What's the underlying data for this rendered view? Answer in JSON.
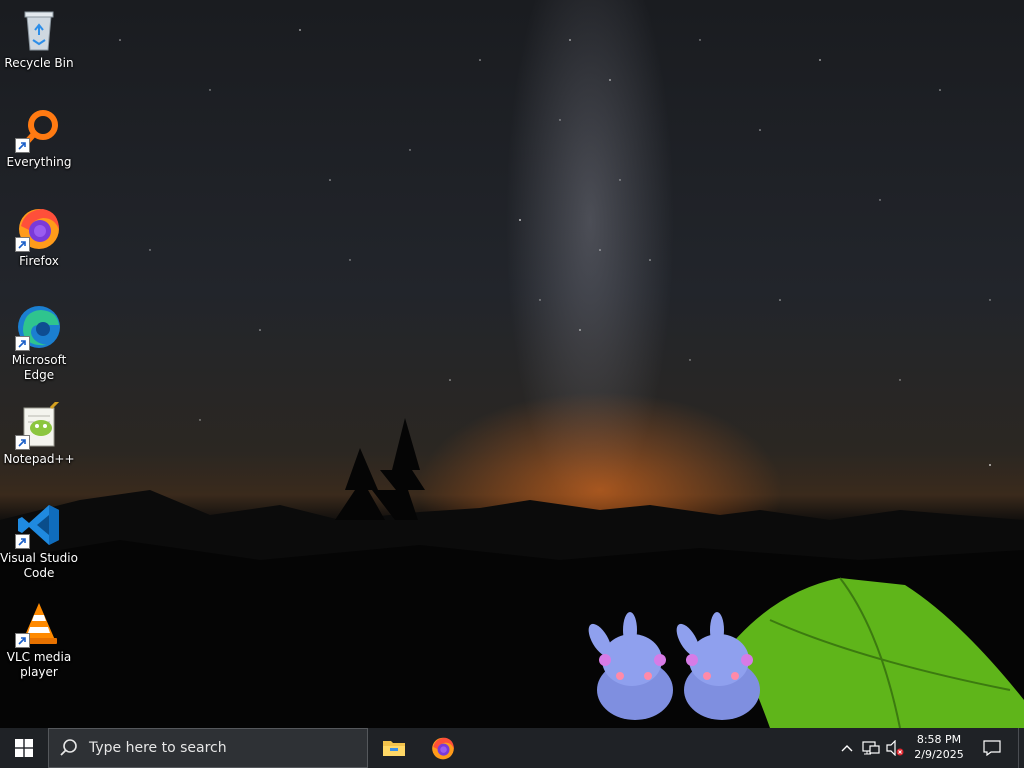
{
  "desktop": {
    "icons": [
      {
        "label": "Recycle Bin",
        "icon": "recycle-bin-icon",
        "shortcut": false
      },
      {
        "label": "Everything",
        "icon": "everything-search-icon",
        "shortcut": true
      },
      {
        "label": "Firefox",
        "icon": "firefox-icon",
        "shortcut": true
      },
      {
        "label": "Microsoft Edge",
        "icon": "edge-icon",
        "shortcut": true
      },
      {
        "label": "Notepad++",
        "icon": "notepad-plus-plus-icon",
        "shortcut": true
      },
      {
        "label": "Visual Studio Code",
        "icon": "vscode-icon",
        "shortcut": true
      },
      {
        "label": "VLC media player",
        "icon": "vlc-icon",
        "shortcut": true
      }
    ],
    "wallpaper": "night-sky-milky-way-tent-wallpaper"
  },
  "taskbar": {
    "start_icon": "windows-logo-icon",
    "search": {
      "placeholder": "Type here to search",
      "icon": "search-icon"
    },
    "pinned": [
      {
        "name": "File Explorer",
        "icon": "file-explorer-icon"
      },
      {
        "name": "Firefox",
        "icon": "firefox-icon"
      }
    ],
    "tray": {
      "icons": [
        "chevron-up-icon",
        "network-icon",
        "volume-muted-icon"
      ],
      "time": "8:58 PM",
      "date": "2/9/2025",
      "notification_icon": "action-center-icon"
    }
  },
  "colors": {
    "taskbar_bg": "#1f2226",
    "search_bg": "#2e3135",
    "accent_tent": "#7ed321",
    "horizon_glow": "#ff7a1e"
  }
}
